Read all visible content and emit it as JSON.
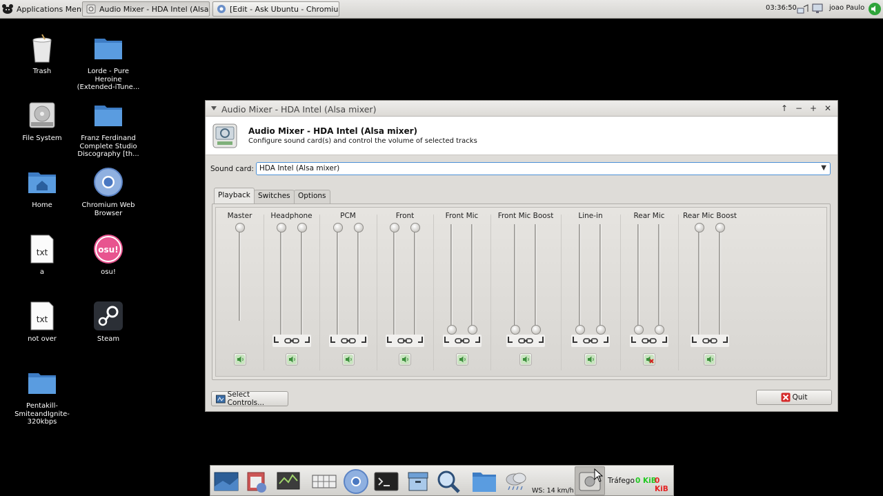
{
  "top_panel": {
    "apps_menu_label": "Applications Menu",
    "tasks": [
      {
        "label": "Audio Mixer - HDA Intel (Alsa mi...",
        "icon": "mixer-icon"
      },
      {
        "label": "[Edit - Ask Ubuntu - Chromium]",
        "icon": "chromium-icon"
      }
    ],
    "clock": "03:36:50",
    "user": "joao Paulo"
  },
  "desktop": {
    "icons": [
      {
        "label": "Trash",
        "icon": "trash-icon"
      },
      {
        "label": "Lorde - Pure Heroine (Extended-iTune...",
        "icon": "folder-icon"
      },
      {
        "label": "File System",
        "icon": "drive-icon"
      },
      {
        "label": "Franz Ferdinand Complete Studio Discography [th...",
        "icon": "folder-icon"
      },
      {
        "label": "Home",
        "icon": "home-folder-icon"
      },
      {
        "label": "Chromium Web Browser",
        "icon": "chromium-icon"
      },
      {
        "label": "a",
        "icon": "text-file-icon"
      },
      {
        "label": "osu!",
        "icon": "osu-icon"
      },
      {
        "label": "not over",
        "icon": "text-file-icon"
      },
      {
        "label": "Steam",
        "icon": "steam-icon"
      },
      {
        "label": "Pentakill-SmiteandIgnite-320kbps",
        "icon": "folder-icon"
      }
    ],
    "file_badge": "txt",
    "osu_badge": "osu!"
  },
  "mixer": {
    "window_title": "Audio Mixer - HDA Intel (Alsa mixer)",
    "header_title": "Audio Mixer - HDA Intel (Alsa mixer)",
    "header_subtitle": "Configure sound card(s) and control the volume of selected tracks",
    "sound_card_label": "Sound card:",
    "sound_card_value": "HDA Intel (Alsa mixer)",
    "tabs": [
      "Playback",
      "Switches",
      "Options"
    ],
    "active_tab": "Playback",
    "channels": [
      {
        "name": "Master",
        "stereo": false,
        "level": 1.0,
        "muted": false
      },
      {
        "name": "Headphone",
        "stereo": true,
        "level": 1.0,
        "muted": false
      },
      {
        "name": "PCM",
        "stereo": true,
        "level": 1.0,
        "muted": false
      },
      {
        "name": "Front",
        "stereo": true,
        "level": 1.0,
        "muted": false
      },
      {
        "name": "Front Mic",
        "stereo": true,
        "level": 0.0,
        "muted": false
      },
      {
        "name": "Front Mic Boost",
        "stereo": true,
        "level": 0.0,
        "muted": false
      },
      {
        "name": "Line-in",
        "stereo": true,
        "level": 0.0,
        "muted": false
      },
      {
        "name": "Rear Mic",
        "stereo": true,
        "level": 0.0,
        "muted": true
      },
      {
        "name": "Rear Mic Boost",
        "stereo": true,
        "level": 1.0,
        "muted": false
      }
    ],
    "select_controls_label": "Select Controls...",
    "quit_label": "Quit"
  },
  "dock": {
    "weather": "WS: 14 km/h",
    "traffic_label": "Tráfego",
    "traffic_down": "0 KiB",
    "traffic_up": "0 KiB"
  },
  "colors": {
    "focus_border": "#4a8fd6",
    "traffic_down": "#22c922",
    "traffic_up": "#e52222",
    "muted_mark": "#d42020"
  }
}
